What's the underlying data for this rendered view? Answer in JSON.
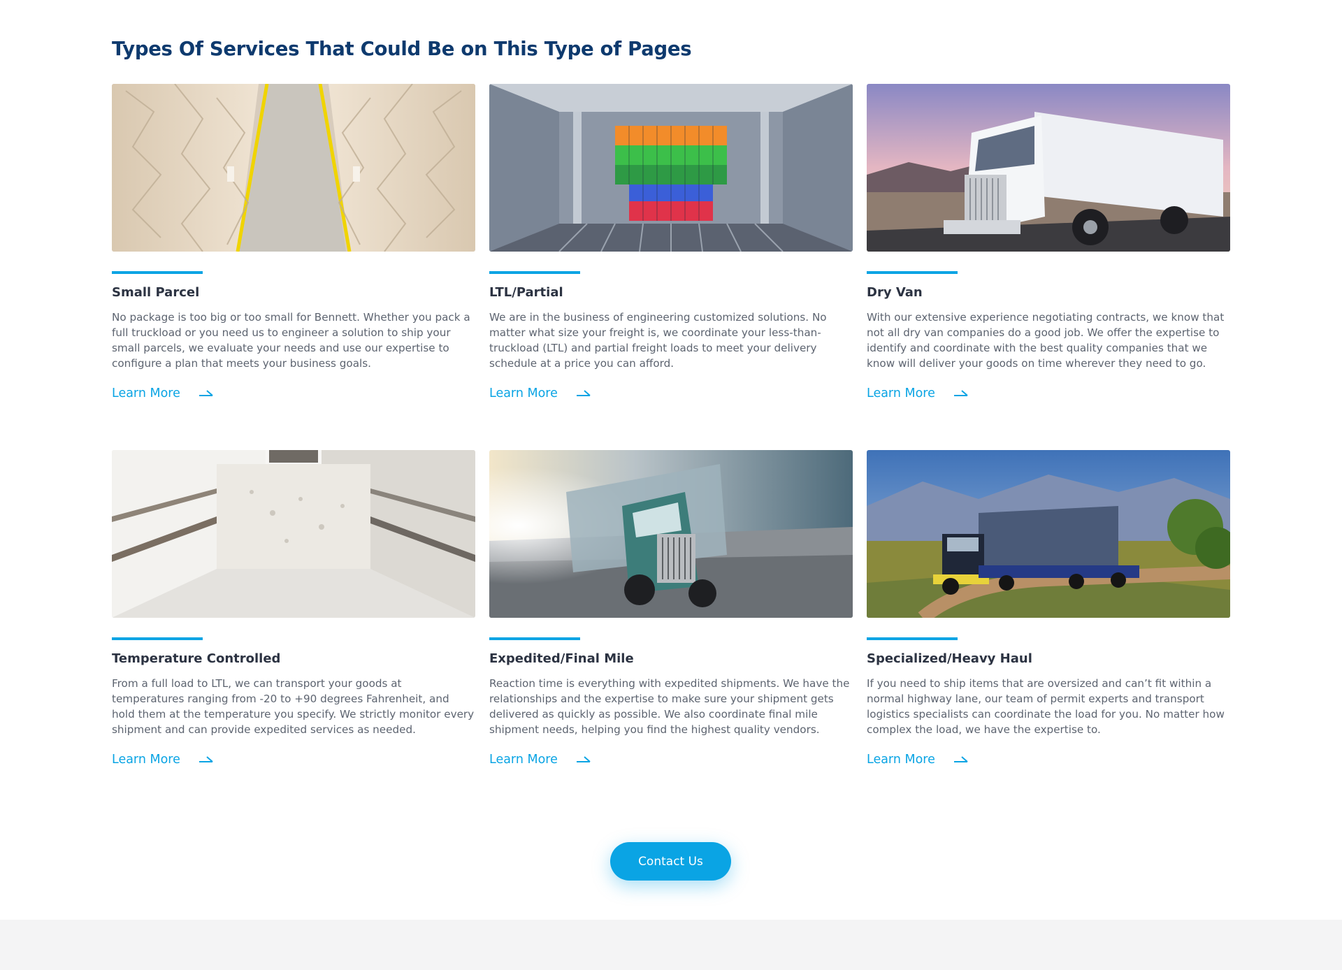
{
  "section": {
    "title": "Types Of Services That Could Be on This Type of Pages"
  },
  "colors": {
    "accent": "#0aa4e4",
    "heading": "#0e3a6e",
    "card_title": "#2c3342",
    "body_text": "#5d6470",
    "footer_band": "#f4f4f5"
  },
  "services": [
    {
      "title": "Small Parcel",
      "description": "No package is too big or too small for Bennett. Whether you pack a full truckload or you need us to engineer a solution to ship your small parcels, we evaluate your needs and use our expertise to configure a plan that meets your business goals.",
      "link_label": "Learn More",
      "link_icon": "arrow-right-icon"
    },
    {
      "title": "LTL/Partial",
      "description": "We are in the business of engineering customized solutions. No matter what size your freight is, we coordinate your less-than-truckload (LTL) and partial freight loads to meet your delivery schedule at a price you can afford.",
      "link_label": "Learn More",
      "link_icon": "arrow-right-icon"
    },
    {
      "title": "Dry Van",
      "description": "With our extensive experience negotiating contracts, we know that not all dry van companies do a good job. We offer the expertise to identify and coordinate with the best quality companies that we know will deliver your goods on time wherever they need to go.",
      "link_label": "Learn More",
      "link_icon": "arrow-right-icon"
    },
    {
      "title": "Temperature Controlled",
      "description": "From a full load to LTL, we can transport your goods at temperatures ranging from -20 to +90 degrees Fahrenheit, and hold them at the temperature you specify. We strictly monitor every shipment and can provide expedited services as needed.",
      "link_label": "Learn More",
      "link_icon": "arrow-right-icon"
    },
    {
      "title": "Expedited/Final Mile",
      "description": "Reaction time is everything with expedited shipments. We have the relationships and the expertise to make sure your shipment gets delivered as quickly as possible. We also coordinate final mile shipment needs, helping you find the highest quality vendors.",
      "link_label": "Learn More",
      "link_icon": "arrow-right-icon"
    },
    {
      "title": "Specialized/Heavy Haul",
      "description": "If you need to ship items that are oversized and can’t fit within a normal highway lane, our team of permit experts and transport logistics specialists can coordinate the load for you. No matter how complex the load, we have the expertise to.",
      "link_label": "Learn More",
      "link_icon": "arrow-right-icon"
    }
  ],
  "cta": {
    "label": "Contact Us"
  }
}
